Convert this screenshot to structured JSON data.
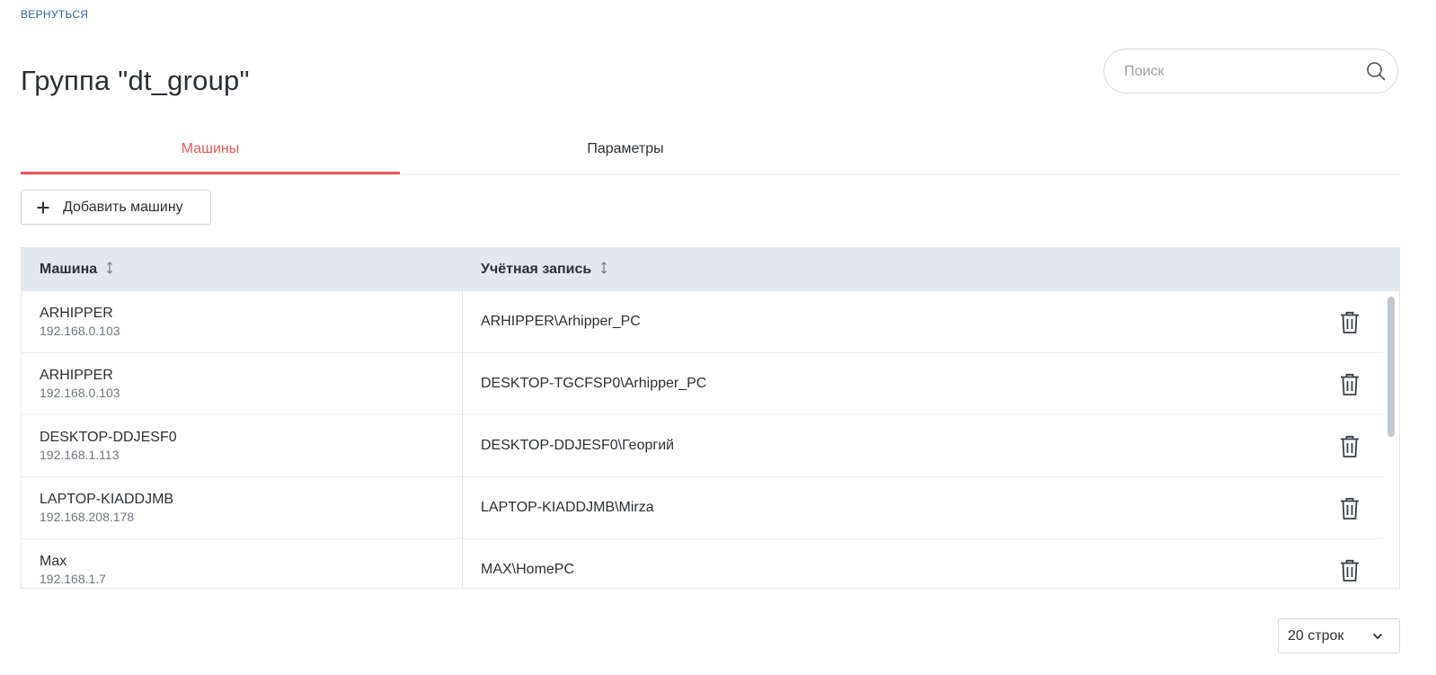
{
  "nav": {
    "back_label": "ВЕРНУТЬСЯ"
  },
  "header": {
    "title": "Группа \"dt_group\""
  },
  "search": {
    "placeholder": "Поиск",
    "value": ""
  },
  "tabs": [
    {
      "label": "Машины",
      "active": true
    },
    {
      "label": "Параметры",
      "active": false
    }
  ],
  "toolbar": {
    "add_machine_label": "Добавить машину"
  },
  "table": {
    "columns": [
      {
        "label": "Машина",
        "sortable": true
      },
      {
        "label": "Учётная запись",
        "sortable": true
      }
    ],
    "rows": [
      {
        "name": "ARHIPPER",
        "ip": "192.168.0.103",
        "account": "ARHIPPER\\Arhipper_PC"
      },
      {
        "name": "ARHIPPER",
        "ip": "192.168.0.103",
        "account": "DESKTOP-TGCFSP0\\Arhipper_PC"
      },
      {
        "name": "DESKTOP-DDJESF0",
        "ip": "192.168.1.113",
        "account": "DESKTOP-DDJESF0\\Георгий"
      },
      {
        "name": "LAPTOP-KIADDJMB",
        "ip": "192.168.208.178",
        "account": "LAPTOP-KIADDJMB\\Mirza"
      },
      {
        "name": "Max",
        "ip": "192.168.1.7",
        "account": "MAX\\HomePC"
      }
    ]
  },
  "pagination": {
    "rows_per_page_label": "20 строк"
  },
  "icons": {
    "search": "search-icon",
    "add": "plus-icon",
    "sort": "sort-icon",
    "delete": "trash-icon",
    "dropdown": "chevron-down-icon"
  },
  "colors": {
    "accent": "#e85a58",
    "link": "#2f5ea8",
    "table_header_bg": "#e3e8f0"
  }
}
